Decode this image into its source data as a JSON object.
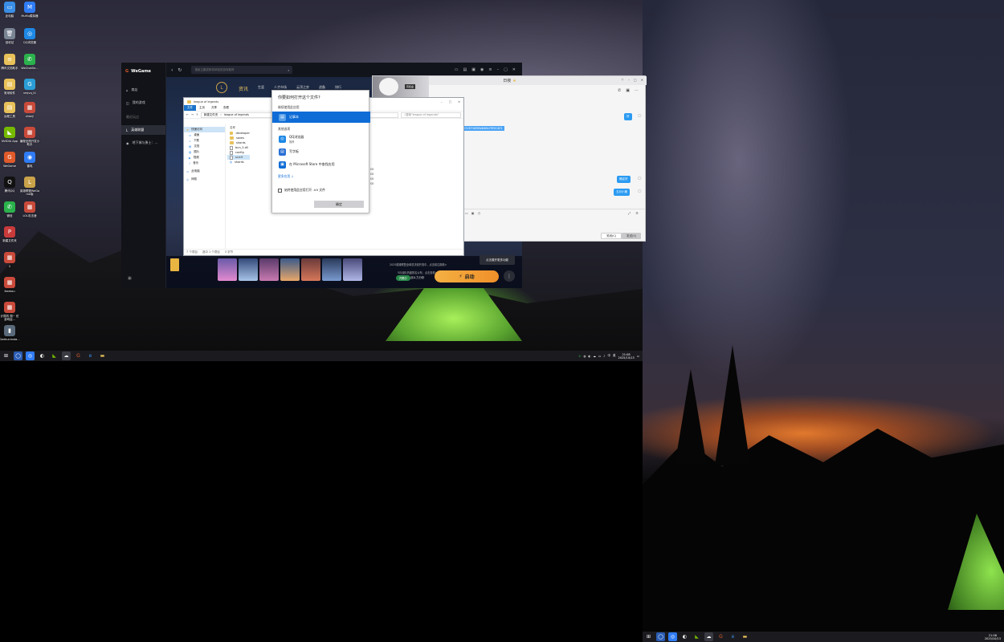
{
  "desktop_icons": [
    {
      "label": "此电脑",
      "color": "#3a8ee6",
      "glyph": "▭"
    },
    {
      "label": "MuMu模拟器",
      "color": "#2f7cf5",
      "glyph": "M"
    },
    {
      "label": "回收站",
      "color": "#7a8594",
      "glyph": "🗑"
    },
    {
      "label": "QQ浏览器",
      "color": "#1e88e5",
      "glyph": "◎"
    },
    {
      "label": "腾讯文档助手",
      "color": "#e8c15a",
      "glyph": "≡"
    },
    {
      "label": "WeChatSe...",
      "color": "#2bb24c",
      "glyph": "✆"
    },
    {
      "label": "常用软件",
      "color": "#e8c15a",
      "glyph": "▤"
    },
    {
      "label": "vmjvq_t1",
      "color": "#2a9dd6",
      "glyph": "G"
    },
    {
      "label": "远程工具",
      "color": "#e8c15a",
      "glyph": "▤"
    },
    {
      "label": "zhanji",
      "color": "#c94a3a",
      "glyph": "▦"
    },
    {
      "label": "NVIDIA App",
      "color": "#76b900",
      "glyph": "◣"
    },
    {
      "label": "编程全栈开发小助手",
      "color": "#c94a3a",
      "glyph": "▦"
    },
    {
      "label": "WeGame",
      "color": "#e05a2a",
      "glyph": "G"
    },
    {
      "label": "雷电",
      "color": "#2f7cf5",
      "glyph": "◉"
    },
    {
      "label": "腾讯QQ",
      "color": "#111",
      "glyph": "Q"
    },
    {
      "label": "英雄联盟WeGame版",
      "color": "#c9a24a",
      "glyph": "L"
    },
    {
      "label": "微信",
      "color": "#2bb24c",
      "glyph": "✆"
    },
    {
      "label": "LOL攻击速",
      "color": "#c94a3a",
      "glyph": "▦"
    },
    {
      "label": "新建文件夹",
      "color": "#c93a3a",
      "glyph": "P"
    },
    {
      "label": "2",
      "color": "#c94a3a",
      "glyph": "▦"
    },
    {
      "label": "foxmou",
      "color": "#c94a3a",
      "glyph": "▦"
    },
    {
      "label": "计算机 国~ 仿游戏运...",
      "color": "#c94a3a",
      "glyph": "▦"
    },
    {
      "label": "Geekuninsta...",
      "color": "#5a6a7a",
      "glyph": "▮"
    }
  ],
  "taskbar": {
    "clock_time": "21:08",
    "clock_date": "2025/10/13",
    "tray_ime": "中",
    "tray_lang": "英"
  },
  "wegame": {
    "logo": "WeGame",
    "search_placeholder": "搜索主题或即将体验的游戏推荐",
    "sidebar_items": [
      "商店",
      "我的游戏",
      "最近玩过",
      "英雄联盟",
      "地下城与勇士：..."
    ],
    "game_tabs": [
      "资讯",
      "生涯",
      "人才市场",
      "云顶之弈",
      "战备",
      "排行"
    ],
    "launch_label": "启动",
    "tooltip": "点击展开更多功能",
    "status_chip": "开黑中",
    "sub_link": "战斗力分析",
    "notice_1": "2025英雄联盟全球总决赛开赛中，点击前往观看>",
    "notice_2": "5月战队热度排名公布，点击查看>"
  },
  "explorer": {
    "title": "league of legends",
    "ribbon_tabs": [
      "文件",
      "主页",
      "共享",
      "查看"
    ],
    "address_parts": [
      "新建文件夹",
      "league of legends"
    ],
    "search_placeholder": "搜索\"league of legends\"",
    "nav_items": [
      "快速访问",
      "桌面",
      "下载",
      "文档",
      "图片",
      "视频",
      "音乐",
      "此电脑",
      "网络"
    ],
    "list_header": "名称",
    "files": [
      {
        "name": "developer",
        "type": "folder"
      },
      {
        "name": "saves",
        "type": "folder"
      },
      {
        "name": "shards",
        "type": "folder"
      },
      {
        "name": "bun_5.dll",
        "type": "file"
      },
      {
        "name": "config",
        "type": "file"
      },
      {
        "name": "sr.lc5",
        "type": "file",
        "selected": true
      },
      {
        "name": "shards",
        "type": "app"
      }
    ],
    "sizes": [
      "1 KB",
      "3 KB",
      "1 KB",
      "2 KB"
    ],
    "status_count": "7 个项目",
    "status_selected": "选中 1 个项目",
    "status_size": "3 字节"
  },
  "chat": {
    "title": "日夜",
    "thumb_label": "有机盒",
    "link_text": "2f3e7c3f7d098e840b7f95C4E1",
    "bubble_1": "好",
    "bubble_2": "确定好",
    "bubble_3": "五月小猪",
    "btn_close": "关闭(C)",
    "btn_send": "发送(S)"
  },
  "openwith": {
    "title": "你要如何打开这个文件?",
    "keep_label": "继续使用此应用",
    "selected_app": "记事本",
    "other_label": "其他选项",
    "apps": [
      {
        "name": "QQ浏览器",
        "sub": "推荐",
        "color": "#1e88e5",
        "glyph": "◎"
      },
      {
        "name": "写字板",
        "sub": "",
        "color": "#2a6fd4",
        "glyph": "▤"
      },
      {
        "name": "在 Microsoft Store 中查找应用",
        "sub": "",
        "color": "#0f6cd6",
        "glyph": "▣"
      }
    ],
    "more_apps": "更多应用 ↓",
    "always_label": "始终使用此应用打开 .lc5 文件",
    "ok_label": "确定"
  }
}
